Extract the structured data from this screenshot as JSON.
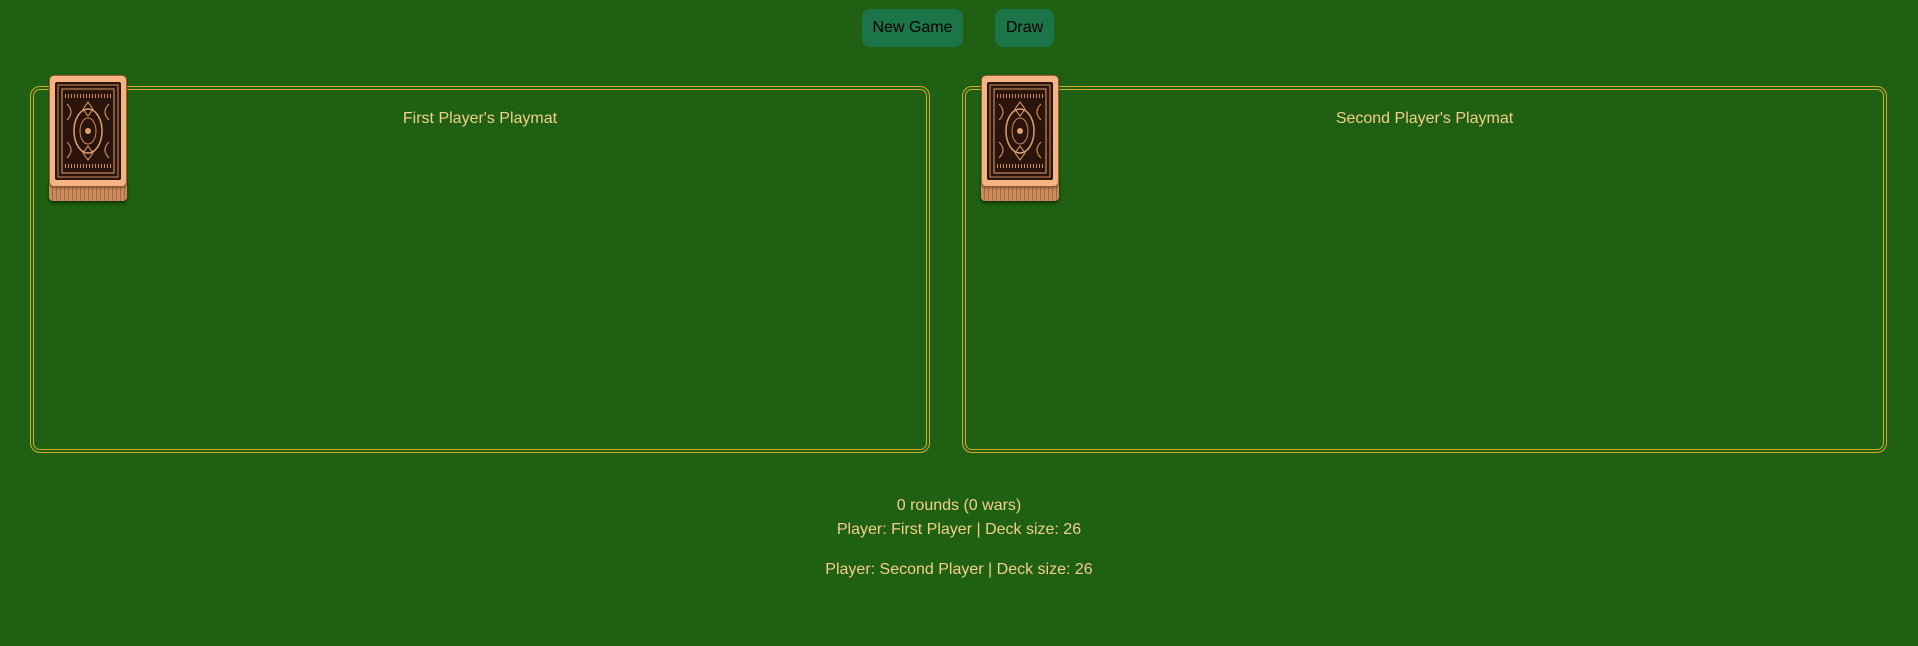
{
  "toolbar": {
    "new_game_label": "New Game",
    "draw_label": "Draw"
  },
  "playmats": [
    {
      "title": "First Player's Playmat"
    },
    {
      "title": "Second Player's Playmat"
    }
  ],
  "status": {
    "rounds": "0 rounds (0 wars)",
    "player1": "Player: First Player | Deck size: 26",
    "player2": "Player: Second Player | Deck size: 26"
  },
  "decks": [
    {
      "icon": "card-back-icon",
      "count": 26
    },
    {
      "icon": "card-back-icon",
      "count": 26
    }
  ],
  "colors": {
    "table": "#206012",
    "button": "#1c7449",
    "accent_text": "#f2d08a",
    "mat_border": "#d4a92a",
    "card_back": "#f6b384"
  }
}
